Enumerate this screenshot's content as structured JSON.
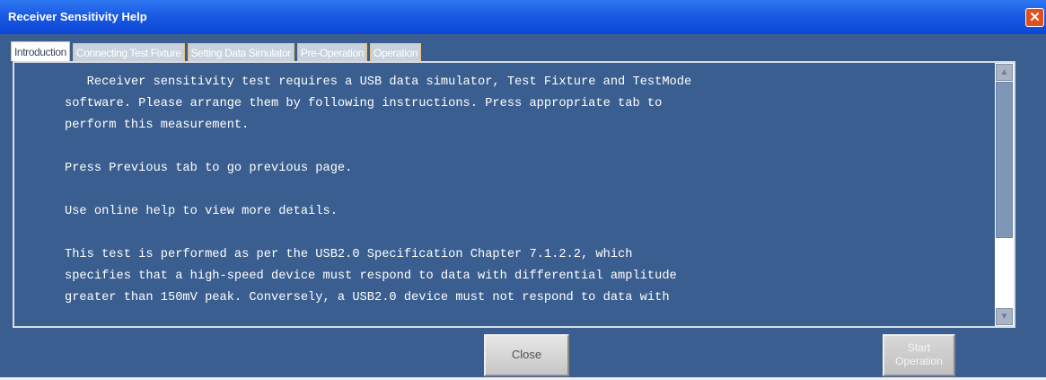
{
  "window": {
    "title": "Receiver Sensitivity Help",
    "close_glyph": "✕"
  },
  "tabs": [
    {
      "label": "Introduction",
      "active": true
    },
    {
      "label": "Connecting Test Fixture",
      "active": false
    },
    {
      "label": "Setting Data Simulator",
      "active": false
    },
    {
      "label": "Pre-Operation",
      "active": false
    },
    {
      "label": "Operation",
      "active": false
    }
  ],
  "content": {
    "text": "   Receiver sensitivity test requires a USB data simulator, Test Fixture and TestMode\nsoftware. Please arrange them by following instructions. Press appropriate tab to\nperform this measurement.\n\nPress Previous tab to go previous page.\n\nUse online help to view more details.\n\nThis test is performed as per the USB2.0 Specification Chapter 7.1.2.2, which\nspecifies that a high-speed device must respond to data with differential amplitude\ngreater than 150mV peak. Conversely, a USB2.0 device must not respond to data with"
  },
  "scrollbar": {
    "up_glyph": "▲",
    "down_glyph": "▼"
  },
  "buttons": {
    "close_label": "Close",
    "start_label": "Start\nOperation"
  },
  "colors": {
    "panel_bg": "#3a5e8f",
    "titlebar": "#1a5ae3",
    "text": "#ffffff"
  }
}
